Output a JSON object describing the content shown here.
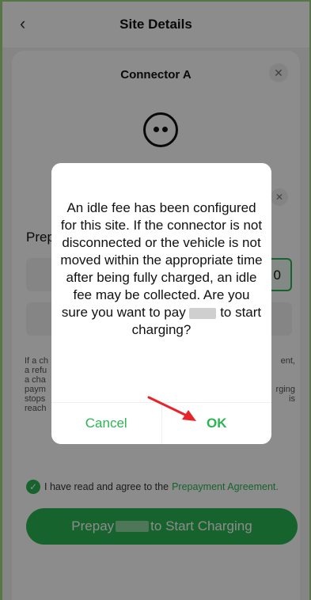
{
  "topbar": {
    "back_icon": "‹",
    "title": "Site Details"
  },
  "connector": {
    "title": "Connector A",
    "close_icon": "✕",
    "plug_icon": "plug-icon",
    "close2_icon": "✕",
    "prepay_label": "Prep",
    "selected_amount_suffix": "0",
    "left_fragment": [
      "If a ch",
      "a refu",
      "a cha",
      "paym",
      "stops",
      "reach"
    ],
    "right_fragment": [
      "ent,",
      "",
      "",
      "rging",
      "is",
      ""
    ]
  },
  "agreement": {
    "text": "I have read and agree to the",
    "link": "Prepayment Agreement."
  },
  "cta": {
    "prefix": "Prepay",
    "suffix": "to Start Charging"
  },
  "dialog": {
    "message_before": "An idle fee has been configured for this site. If the connector is not disconnected or the vehicle is not moved within the appropriate time after being fully charged, an idle fee may be collected. Are you sure you want to pay",
    "message_after": "to start charging?",
    "cancel": "Cancel",
    "ok": "OK"
  },
  "colors": {
    "accent": "#2bb552",
    "arrow": "#e8232a"
  }
}
